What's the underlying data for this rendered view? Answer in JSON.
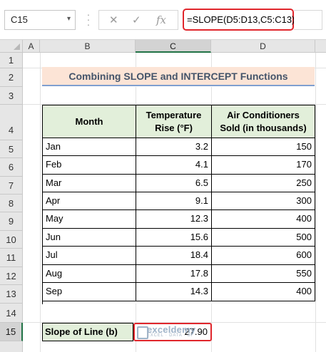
{
  "formula_bar": {
    "name_box": "C15",
    "name_box_dropdown": "▾",
    "cancel_icon": "✕",
    "enter_icon": "✓",
    "fx_icon": "fx",
    "formula": "=SLOPE(D5:D13,C5:C13)"
  },
  "columns": [
    "A",
    "B",
    "C",
    "D"
  ],
  "selected_column": "C",
  "rows": [
    "1",
    "2",
    "3",
    "4",
    "5",
    "6",
    "7",
    "8",
    "9",
    "10",
    "11",
    "12",
    "13",
    "14",
    "15"
  ],
  "selected_row": "15",
  "title": "Combining SLOPE and INTERCEPT Functions",
  "table": {
    "headers": {
      "month": "Month",
      "temp_line1": "Temperature",
      "temp_line2": "Rise (°F)",
      "ac_line1": "Air Conditioners",
      "ac_line2": "Sold (in thousands)"
    },
    "rows": [
      {
        "month": "Jan",
        "temp": "3.2",
        "sold": "150"
      },
      {
        "month": "Feb",
        "temp": "4.1",
        "sold": "170"
      },
      {
        "month": "Mar",
        "temp": "6.5",
        "sold": "250"
      },
      {
        "month": "Apr",
        "temp": "9.1",
        "sold": "300"
      },
      {
        "month": "May",
        "temp": "12.3",
        "sold": "400"
      },
      {
        "month": "Jun",
        "temp": "15.6",
        "sold": "500"
      },
      {
        "month": "Jul",
        "temp": "18.4",
        "sold": "600"
      },
      {
        "month": "Aug",
        "temp": "17.8",
        "sold": "550"
      },
      {
        "month": "Sep",
        "temp": "14.3",
        "sold": "400"
      }
    ]
  },
  "result": {
    "label": "Slope of Line (b)",
    "value": "27.90"
  },
  "watermark": {
    "main": "exceldemy",
    "sub": "EXCEL · DATA · BI"
  },
  "colors": {
    "accent_red": "#e0262c",
    "header_green": "#e2efda",
    "title_bg": "#fce4d6",
    "selection_green": "#217346"
  }
}
